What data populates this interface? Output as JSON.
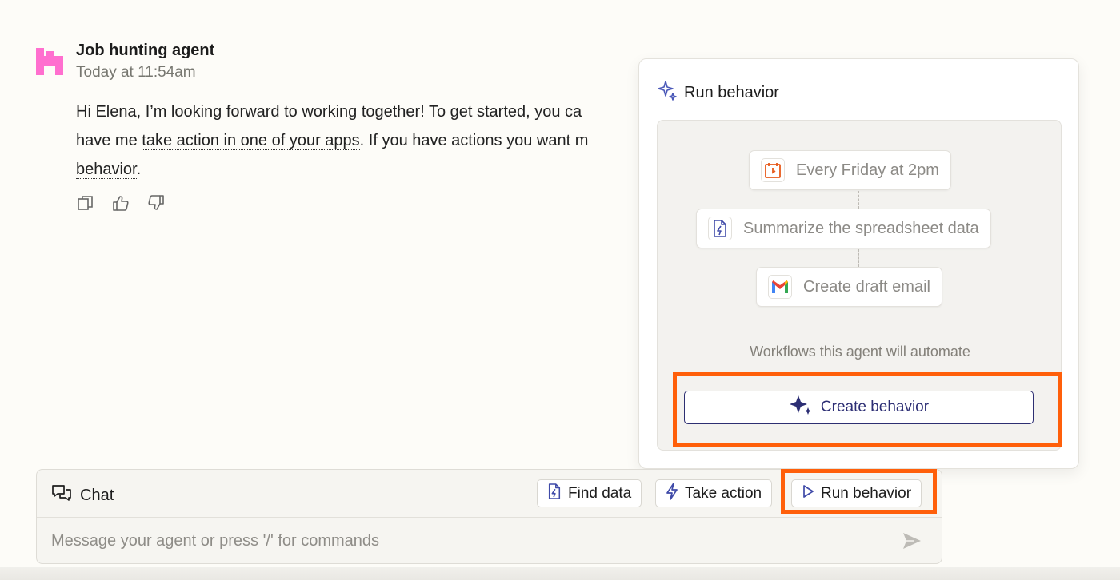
{
  "agent": {
    "name": "Job hunting agent",
    "timestamp": "Today at 11:54am",
    "message": {
      "part1": "Hi Elena, I’m looking forward to working together! To get started, you ca",
      "part2": "have me ",
      "link1": "take action in one of your apps",
      "part3": ". If you have actions you want m",
      "link2": "behavior",
      "part4": "."
    },
    "actions": [
      {
        "icon": "copy-icon"
      },
      {
        "icon": "thumbs-up-icon"
      },
      {
        "icon": "thumbs-down-icon"
      }
    ],
    "avatar_color": "#ff6fcf"
  },
  "popover": {
    "title": "Run behavior",
    "title_icon": "sparkle-outline-icon",
    "steps": [
      {
        "label": "Every Friday at 2pm",
        "icon": "calendar-icon",
        "icon_color": "#e8591a"
      },
      {
        "label": "Summarize the spreadsheet data",
        "icon": "document-bolt-icon",
        "icon_color": "#3f4aa8"
      },
      {
        "label": "Create draft email",
        "icon": "gmail-icon",
        "icon_color": "#ea4335"
      }
    ],
    "caption": "Workflows this agent will automate",
    "create_button": "Create behavior",
    "create_icon": "sparkle-filled-icon"
  },
  "chat": {
    "label": "Chat",
    "label_icon": "chat-bubbles-icon",
    "buttons": [
      {
        "label": "Find data",
        "icon": "document-bolt-icon"
      },
      {
        "label": "Take action",
        "icon": "bolt-icon"
      },
      {
        "label": "Run behavior",
        "icon": "play-icon"
      }
    ],
    "placeholder": "Message your agent or press '/' for commands",
    "send_icon": "send-icon"
  },
  "highlight_color": "#ff5f0a",
  "accent": "#2c2e74"
}
